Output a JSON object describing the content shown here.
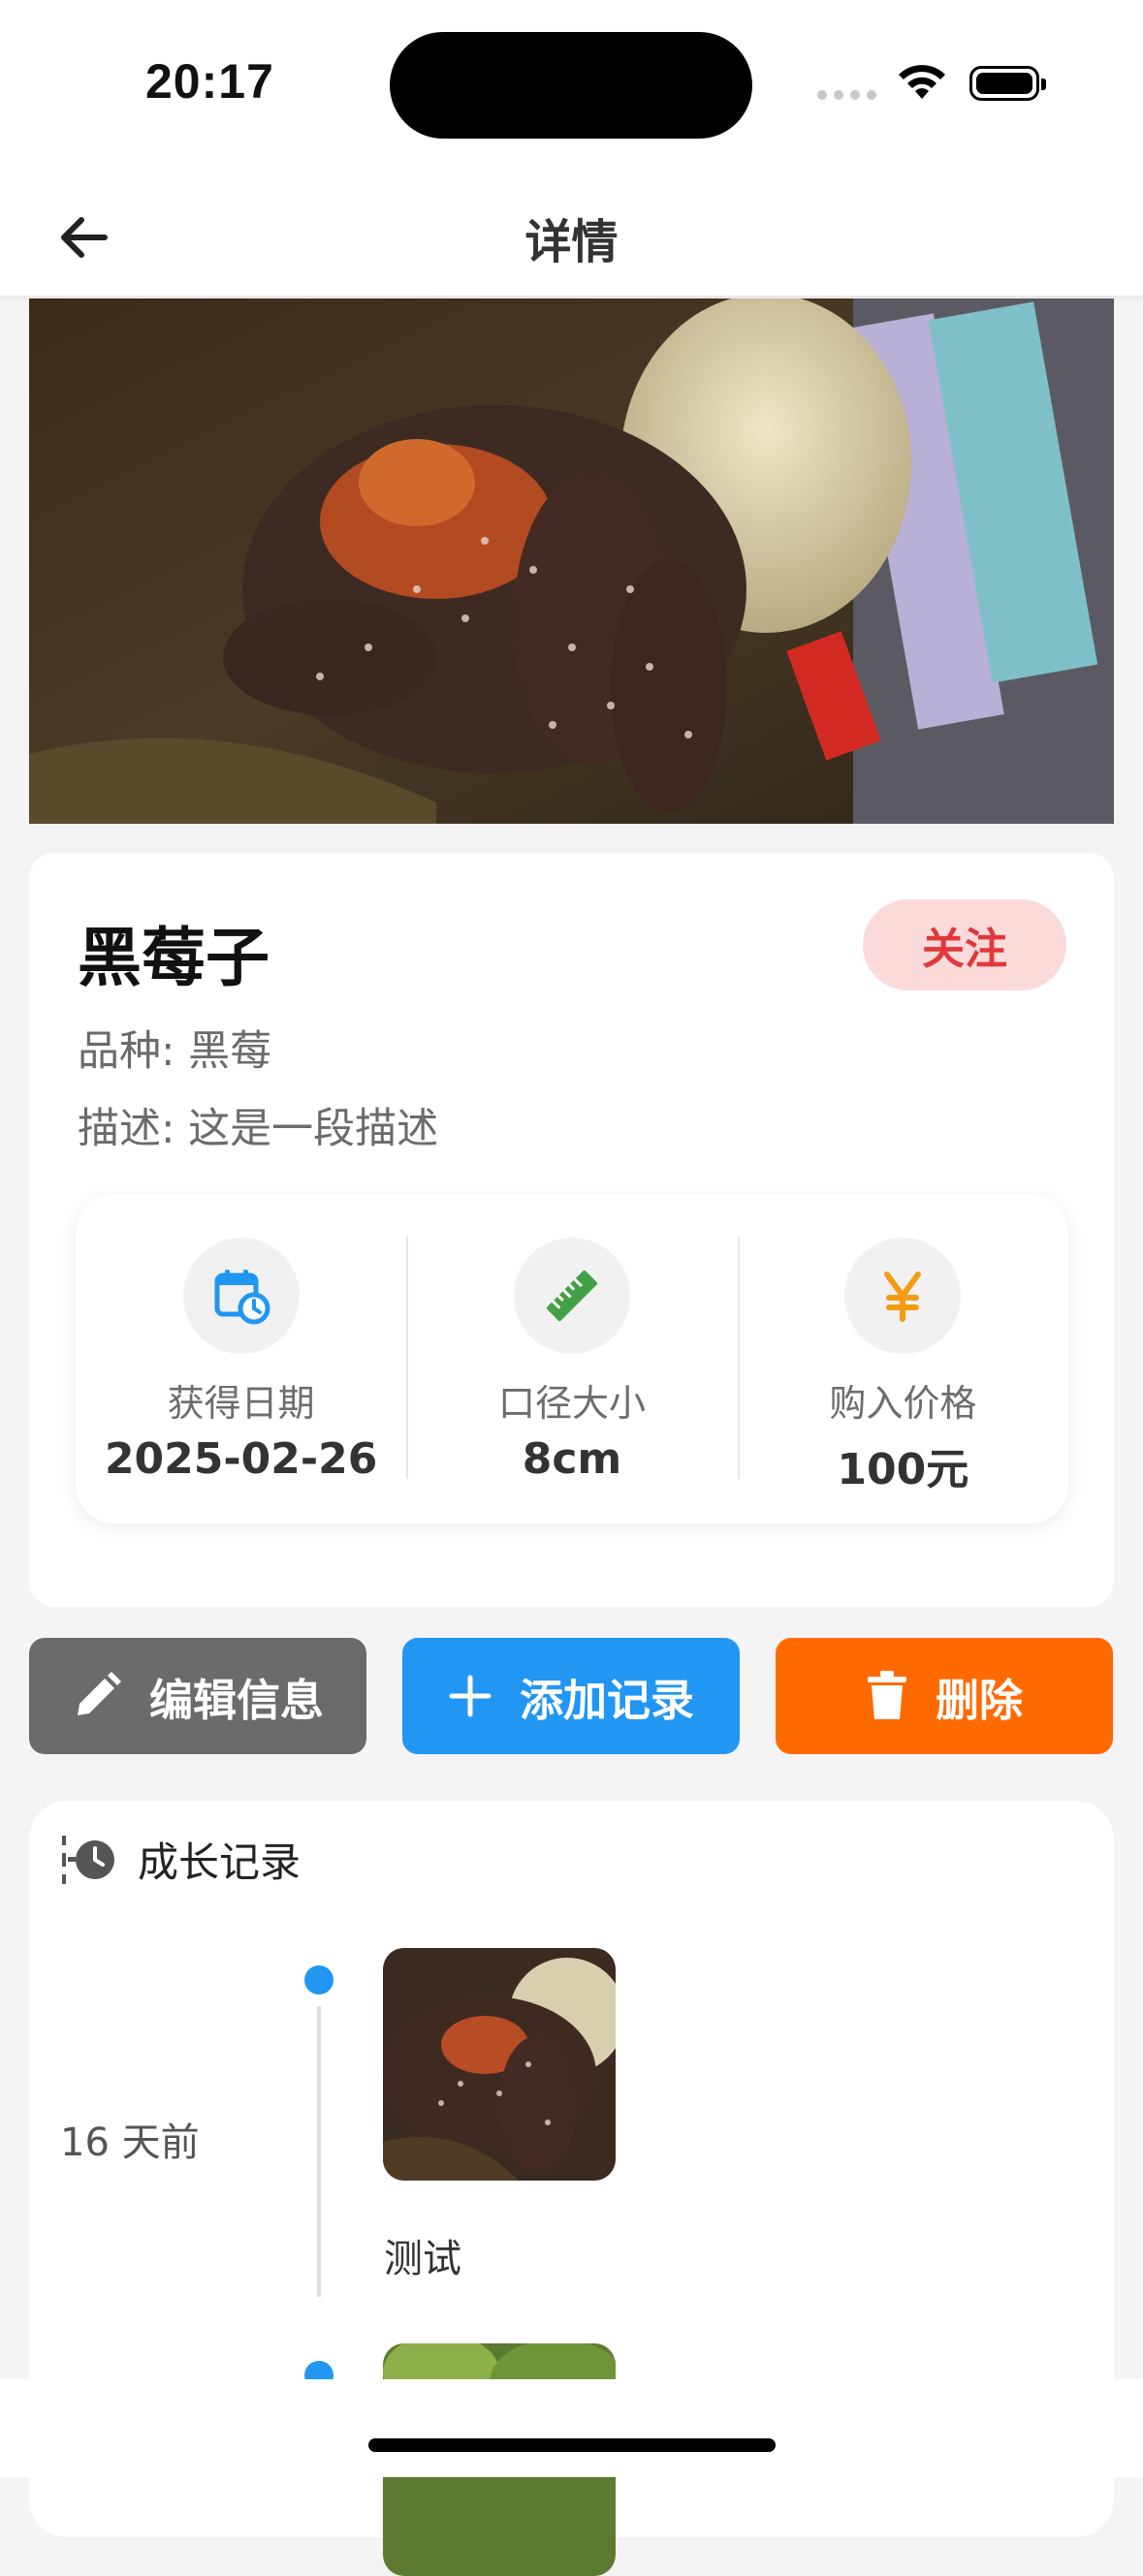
{
  "status_bar": {
    "time": "20:17"
  },
  "nav": {
    "title": "详情",
    "back_icon": "arrow-left-icon"
  },
  "pet": {
    "name": "黑莓子",
    "follow_label": "关注",
    "breed_label": "品种: ",
    "breed": "黑莓",
    "desc_label": "描述: ",
    "desc": "这是一段描述"
  },
  "stats": [
    {
      "icon": "calendar-clock-icon",
      "label": "获得日期",
      "value": "2025-02-26",
      "color": "#2196f3"
    },
    {
      "icon": "ruler-icon",
      "label": "口径大小",
      "value": "8cm",
      "color": "#43a047"
    },
    {
      "icon": "yen-icon",
      "label": "购入价格",
      "value": "100元",
      "color": "#f39c12"
    }
  ],
  "actions": {
    "edit": "编辑信息",
    "add": "添加记录",
    "delete": "删除"
  },
  "records": {
    "title": "成长记录",
    "items": [
      {
        "date": "16 天前",
        "note": "测试"
      }
    ]
  },
  "colors": {
    "primary": "#2196f3",
    "danger": "#ff6a00",
    "neutral": "#6b6b6b",
    "follow_bg": "#fbdada",
    "follow_text": "#e0383a"
  }
}
